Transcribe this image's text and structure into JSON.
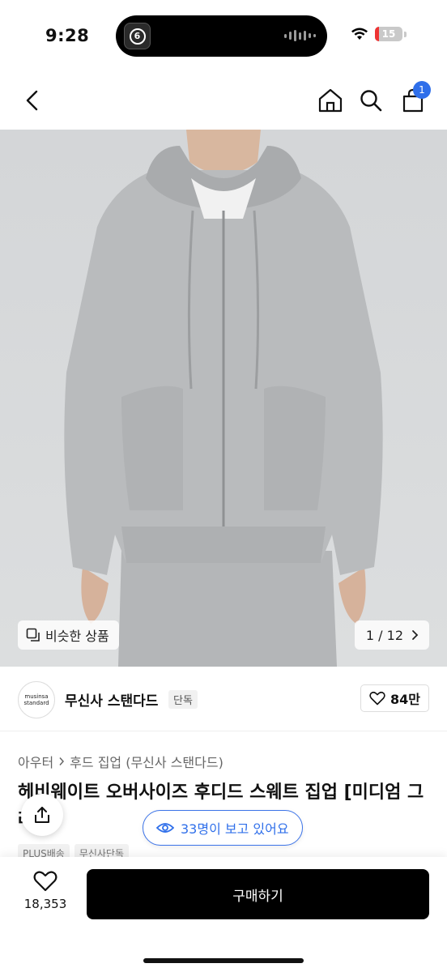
{
  "status_bar": {
    "time": "9:28",
    "battery_level": "15",
    "island_app_glyph": "6"
  },
  "nav": {
    "cart_count": "1"
  },
  "gallery": {
    "similar_label": "비슷한 상품",
    "counter": "1 / 12"
  },
  "brand": {
    "logo_line1": "musinsa",
    "logo_line2": "standard",
    "name": "무신사 스탠다드",
    "tag": "단독",
    "likes": "84만"
  },
  "product": {
    "breadcrumb": [
      "아우터",
      "후드 집업 (무신사 스탠다드)"
    ],
    "title": "헤비웨이트 오버사이즈 후디드 스웨트 집업 [미디엄 그레이]",
    "tags": [
      "PLUS배송",
      "무신사단독"
    ]
  },
  "viewers": {
    "label": "33명이 보고 있어요"
  },
  "bottom_bar": {
    "wish_count": "18,353",
    "buy_label": "구매하기"
  },
  "colors": {
    "accent_blue": "#2f6fea",
    "buy_button": "#000000",
    "garment": "#b9bbbd"
  }
}
